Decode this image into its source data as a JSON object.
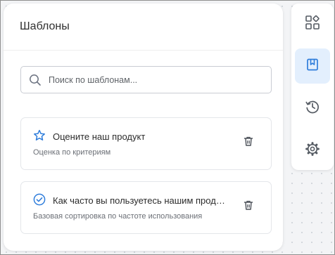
{
  "panel": {
    "title": "Шаблоны"
  },
  "search": {
    "placeholder": "Поиск по шаблонам..."
  },
  "templates": [
    {
      "title": "Оцените наш продукт",
      "subtitle": "Оценка по критериям",
      "icon": "star-icon"
    },
    {
      "title": "Как часто вы пользуетесь нашим продуктом?",
      "subtitle": "Базовая сортировка по частоте использования",
      "icon": "check-circle-icon"
    }
  ],
  "toolbar": {
    "items": [
      {
        "icon": "widgets-icon",
        "active": false
      },
      {
        "icon": "bookmark-icon",
        "active": true
      },
      {
        "icon": "history-icon",
        "active": false
      },
      {
        "icon": "gear-icon",
        "active": false
      }
    ]
  },
  "colors": {
    "accent": "#2f7ddb",
    "active_bg": "#e3effd",
    "icon_gray": "#555b63",
    "canvas_bg": "#f3f4f6"
  }
}
